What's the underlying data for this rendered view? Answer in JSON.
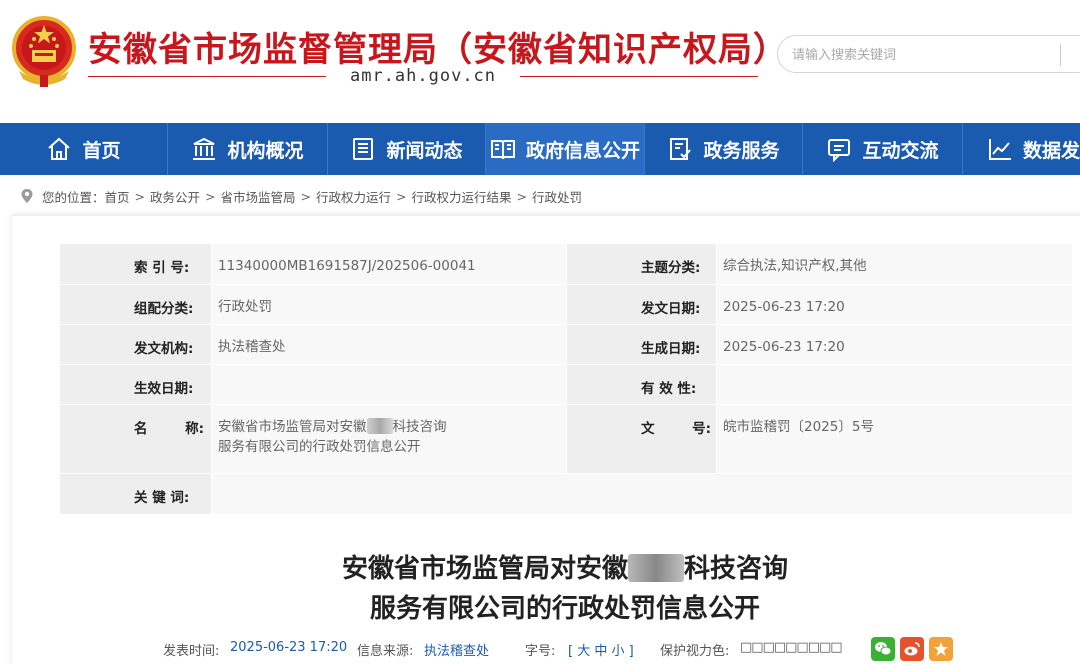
{
  "header": {
    "site_title": "安徽省市场监督管理局（安徽省知识产权局）",
    "domain": "amr.ah.gov.cn",
    "search_placeholder": "请输入搜索关键词"
  },
  "nav": {
    "items": [
      {
        "label": "首页",
        "icon": "home-icon"
      },
      {
        "label": "机构概况",
        "icon": "building-icon"
      },
      {
        "label": "新闻动态",
        "icon": "news-icon"
      },
      {
        "label": "政府信息公开",
        "icon": "book-icon"
      },
      {
        "label": "政务服务",
        "icon": "document-icon"
      },
      {
        "label": "互动交流",
        "icon": "chat-icon"
      },
      {
        "label": "数据发",
        "icon": "chart-icon"
      }
    ],
    "active": "政府信息公开"
  },
  "breadcrumb": {
    "prefix": "您的位置：",
    "items": [
      "首页",
      "政务公开",
      "省市场监管局",
      "行政权力运行",
      "行政权力运行结果",
      "行政处罚"
    ],
    "separator": ">"
  },
  "info": {
    "index_label": "索 引 号:",
    "index_value": "11340000MB1691587J/202506-00041",
    "topic_label": "主题分类:",
    "topic_value": "综合执法,知识产权,其他",
    "group_label": "组配分类:",
    "group_value": "行政处罚",
    "issue_date_label": "发文日期:",
    "issue_date_value": "2025-06-23 17:20",
    "org_label": "发文机构:",
    "org_value": "执法稽查处",
    "gen_date_label": "生成日期:",
    "gen_date_value": "2025-06-23 17:20",
    "effective_label": "生效日期:",
    "effective_value": "",
    "validity_label": "有 效 性:",
    "validity_value": "",
    "name_label": "名        称:",
    "name_value_part1": "安徽省市场监管局对安徽",
    "name_value_part2": "科技咨询",
    "name_value_line2": "服务有限公司的行政处罚信息公开",
    "docno_label": "文        号:",
    "docno_value": "皖市监稽罚〔2025〕5号",
    "keywords_label": "关 键 词:",
    "keywords_value": ""
  },
  "article": {
    "title_line1_part1": "安徽省市场监管局对安徽",
    "title_line1_part2": "科技咨询",
    "title_line2": "服务有限公司的行政处罚信息公开"
  },
  "meta": {
    "time_label": "发表时间:",
    "time_value": "2025-06-23 17:20",
    "source_label": "信息来源:",
    "source_value": "执法稽查处",
    "font_label": "字号:",
    "font_value": "[ 大 中 小 ]",
    "eye_label": "保护视力色:",
    "eye_value": "□□□□□□□□□"
  },
  "colors": {
    "brand_red": "#c8161d",
    "nav_blue": "#1a5bb0",
    "wechat_green": "#3cb034",
    "weibo_red": "#e6522c",
    "favorite_orange": "#f2a23a"
  }
}
